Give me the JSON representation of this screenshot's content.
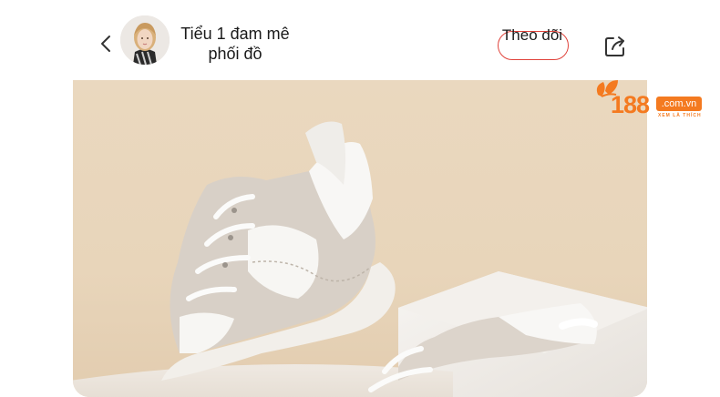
{
  "header": {
    "back_icon": "chevron-left-icon",
    "profile_name": "Tiểu 1 đam mê phối đồ",
    "follow_label": "Theo dõi",
    "share_icon": "share-icon"
  },
  "watermark": {
    "brand": "188",
    "domain": ".com.vn",
    "tagline": "XEM LÀ THÍCH"
  },
  "colors": {
    "accent": "#e0433b",
    "brand": "#f47a20",
    "photo_background": "#e8d5ba"
  }
}
